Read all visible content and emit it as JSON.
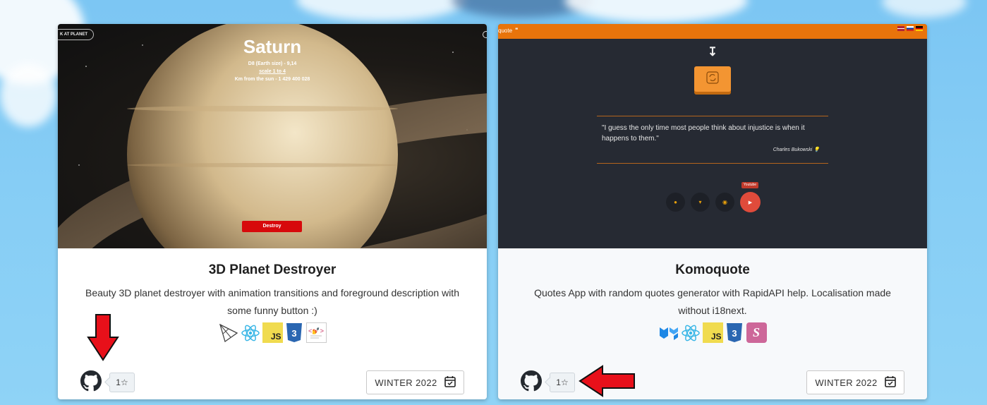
{
  "projects": [
    {
      "title": "3D Planet Destroyer",
      "description": "Beauty 3D planet destroyer with animation transitions and foreground description with some funny button :)",
      "stars": "1☆",
      "season": "WINTER 2022",
      "tech_icons": [
        "threejs-icon",
        "react-icon",
        "javascript-icon",
        "css3-icon",
        "styled-components-icon"
      ],
      "preview": {
        "back_label": "K AT PLANET",
        "planet_name": "Saturn",
        "info_line1": "D8 (Earth size) - 9,14",
        "info_line2": "scale 1 to 4",
        "info_line3": "Km from the sun - 1 429 400 028",
        "destroy_label": "Destroy"
      }
    },
    {
      "title": "Komoquote",
      "description": "Quotes App with random quotes generator with RapidAPI help. Localisation made without i18next.",
      "stars": "1☆",
      "season": "WINTER 2022",
      "tech_icons": [
        "mui-icon",
        "react-icon",
        "javascript-icon",
        "css3-icon",
        "sass-icon"
      ],
      "preview": {
        "app_name": "quote",
        "quote_text": "\"I guess the only time most people think about injustice is when it happens to them.\"",
        "quote_author": "Charles Bukowski",
        "tooltip": "Youtube"
      }
    }
  ],
  "colors": {
    "arrow_red": "#e8101a",
    "komoquote_orange": "#e8740b",
    "komoquote_bg": "#262a33",
    "destroy_red": "#d7090b"
  }
}
